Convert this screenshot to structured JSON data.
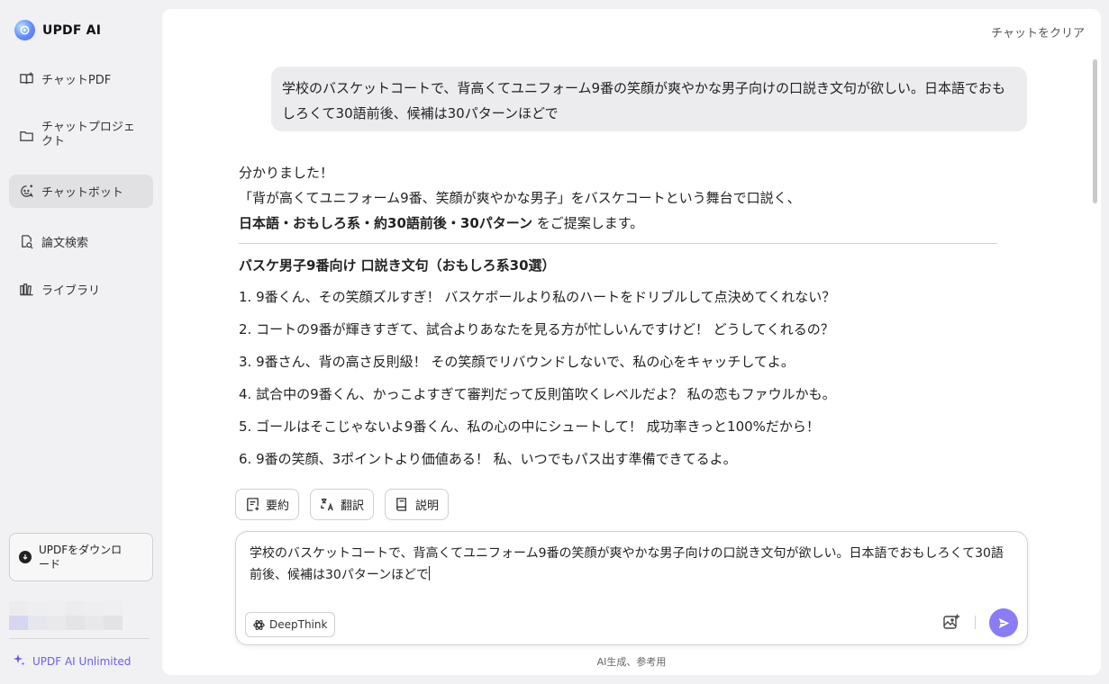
{
  "app": {
    "name": "UPDF AI"
  },
  "sidebar": {
    "items": [
      {
        "label": "チャットPDF",
        "icon": "book-open-icon"
      },
      {
        "label": "チャットプロジェクト",
        "icon": "folder-icon"
      },
      {
        "label": "チャットボット",
        "icon": "chatbot-icon",
        "active": true
      },
      {
        "label": "論文検索",
        "icon": "search-paper-icon"
      },
      {
        "label": "ライブラリ",
        "icon": "library-icon"
      }
    ],
    "download_label": "UPDFをダウンロード",
    "unlimited_label": "UPDF AI Unlimited"
  },
  "header": {
    "clear_chat": "チャットをクリア"
  },
  "chat": {
    "user_message": "学校のバスケットコートで、背高くてユニフォーム9番の笑顔が爽やかな男子向けの口説き文句が欲しい。日本語でおもしろくて30語前後、候補は30パターンほどで",
    "answer": {
      "intro1": "分かりました！",
      "intro2": "「背が高くてユニフォーム9番、笑顔が爽やかな男子」をバスケコートという舞台で口説く、",
      "intro3_bold": "日本語・おもしろ系・約30語前後・30パターン",
      "intro3_rest": " をご提案します。",
      "heading": "バスケ男子9番向け 口説き文句（おもしろ系30選）",
      "items": [
        "1.  9番くん、その笑顔ズルすぎ！ バスケボールより私のハートをドリブルして点決めてくれない？",
        "2. コートの9番が輝きすぎて、試合よりあなたを見る方が忙しいんですけど！ どうしてくれるの？",
        "3. 9番さん、背の高さ反則級！ その笑顔でリバウンドしないで、私の心をキャッチしてよ。",
        "4. 試合中の9番くん、かっこよすぎて審判だって反則笛吹くレベルだよ？ 私の恋もファウルかも。",
        "5. ゴールはそこじゃないよ9番くん、私の心の中にシュートして！ 成功率きっと100%だから！",
        "6. 9番の笑顔、3ポイントより価値ある！ 私、いつでもパス出す準備できてるよ。"
      ]
    },
    "actions": {
      "summarize": "要約",
      "translate": "翻訳",
      "explain": "説明"
    }
  },
  "composer": {
    "text": "学校のバスケットコートで、背高くてユニフォーム9番の笑顔が爽やかな男子向けの口説き文句が欲しい。日本語でおもしろくて30語前後、候補は30パターンほどで",
    "deepthink_label": "DeepThink"
  },
  "footer": {
    "note": "AI生成、参考用"
  },
  "colors": {
    "accent": "#8a7cf5",
    "unlimited": "#6a5cf0",
    "active_nav": "#e1e1e4"
  }
}
